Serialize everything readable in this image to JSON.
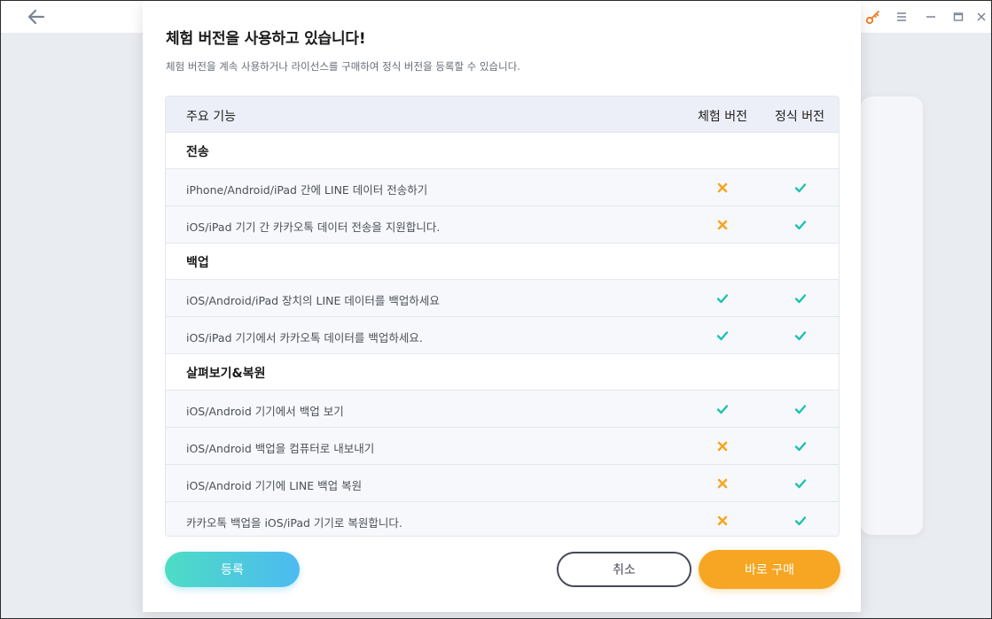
{
  "dialog": {
    "title": "체험 버전을 사용하고 있습니다!",
    "subtitle": "체험 버전을 계속 사용하거나 라이선스를 구매하여 정식 버전을 등록할 수 있습니다."
  },
  "table": {
    "headers": {
      "feature": "주요 기능",
      "trial": "체험 버전",
      "full": "정식 버전"
    },
    "sections": [
      {
        "title": "전송",
        "rows": [
          {
            "label": "iPhone/Android/iPad 간에 LINE 데이터 전송하기",
            "trial": "cross",
            "full": "check"
          },
          {
            "label": "iOS/iPad 기기 간 카카오톡 데이터 전송을 지원합니다.",
            "trial": "cross",
            "full": "check"
          }
        ]
      },
      {
        "title": "백업",
        "rows": [
          {
            "label": "iOS/Android/iPad 장치의 LINE 데이터를 백업하세요",
            "trial": "check",
            "full": "check"
          },
          {
            "label": "iOS/iPad 기기에서 카카오톡 데이터를 백업하세요.",
            "trial": "check",
            "full": "check"
          }
        ]
      },
      {
        "title": "살펴보기&복원",
        "rows": [
          {
            "label": "iOS/Android 기기에서 백업 보기",
            "trial": "check",
            "full": "check"
          },
          {
            "label": "iOS/Android 백업을 컴퓨터로 내보내기",
            "trial": "cross",
            "full": "check"
          },
          {
            "label": "iOS/Android 기기에 LINE 백업 복원",
            "trial": "cross",
            "full": "check"
          },
          {
            "label": "카카오톡 백업을 iOS/iPad 기기로 복원합니다.",
            "trial": "cross",
            "full": "check"
          }
        ]
      }
    ]
  },
  "buttons": {
    "register": "등록",
    "cancel": "취소",
    "buy": "바로 구매"
  },
  "icons": {
    "check": "check-icon",
    "cross": "cross-icon"
  },
  "colors": {
    "check": "#1ec2b0",
    "cross": "#f5a623",
    "key": "#f07b22",
    "buy": "#f6a623"
  }
}
